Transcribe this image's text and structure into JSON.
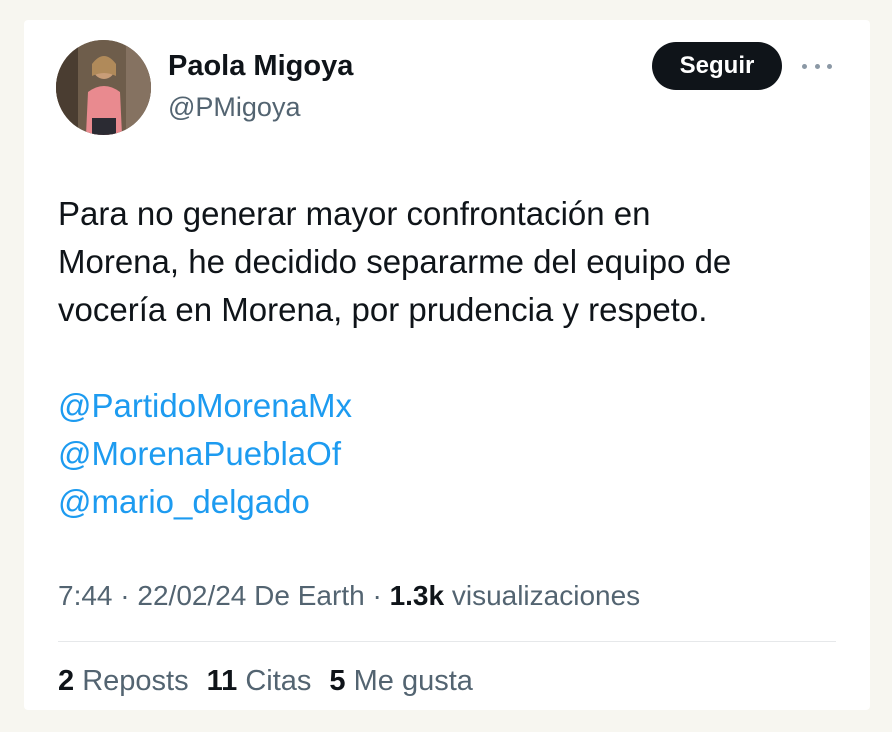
{
  "author": {
    "display_name": "Paola Migoya",
    "handle": "@PMigoya"
  },
  "follow_label": "Seguir",
  "icons": {
    "more": "more-options-icon",
    "avatar": "avatar"
  },
  "tweet": {
    "lines": [
      "Para no generar mayor confrontación en",
      "Morena, he decidido separarme del equipo de",
      "vocería en Morena, por prudencia y respeto."
    ],
    "mentions": [
      "@PartidoMorenaMx",
      "@MorenaPueblaOf",
      "@mario_delgado"
    ]
  },
  "meta": {
    "time": "7:44",
    "separator": "·",
    "date": "22/02/24",
    "source": "De Earth",
    "views_count": "1.3k",
    "views_label": "visualizaciones"
  },
  "stats": {
    "reposts_count": "2",
    "reposts_label": "Reposts",
    "quotes_count": "11",
    "quotes_label": "Citas",
    "likes_count": "5",
    "likes_label": "Me gusta"
  },
  "colors": {
    "link": "#1d9bf0",
    "text": "#0f1419",
    "secondary": "#536471",
    "button_bg": "#0f1419"
  }
}
